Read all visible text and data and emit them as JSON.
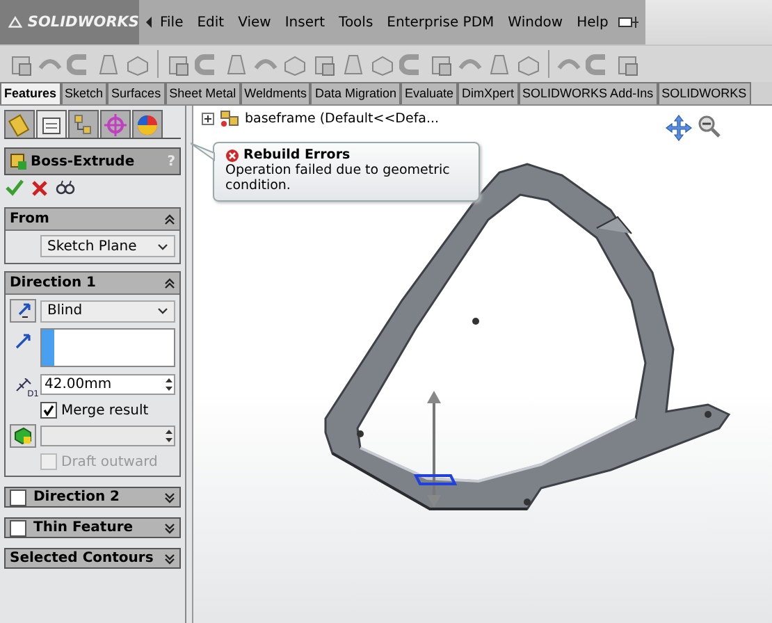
{
  "app": {
    "logo": "SOLIDWORKS"
  },
  "menu": [
    "File",
    "Edit",
    "View",
    "Insert",
    "Tools",
    "Enterprise PDM",
    "Window",
    "Help"
  ],
  "command_tabs": [
    {
      "label": "Features",
      "selected": true
    },
    {
      "label": "Sketch",
      "selected": false
    },
    {
      "label": "Surfaces",
      "selected": false
    },
    {
      "label": "Sheet Metal",
      "selected": false
    },
    {
      "label": "Weldments",
      "selected": false
    },
    {
      "label": "Data Migration",
      "selected": false
    },
    {
      "label": "Evaluate",
      "selected": false
    },
    {
      "label": "DimXpert",
      "selected": false
    },
    {
      "label": "SOLIDWORKS Add-Ins",
      "selected": false
    },
    {
      "label": "SOLIDWORKS",
      "selected": false
    }
  ],
  "panel_tabs": [
    {
      "kind": "feature",
      "selected": false
    },
    {
      "kind": "property",
      "selected": true
    },
    {
      "kind": "config",
      "selected": false
    },
    {
      "kind": "dimxpert",
      "selected": false
    },
    {
      "kind": "display",
      "selected": false
    }
  ],
  "property_manager": {
    "title": "Boss-Extrude",
    "help": "?",
    "from": {
      "title": "From",
      "value": "Sketch Plane"
    },
    "direction1": {
      "title": "Direction 1",
      "end_condition": "Blind",
      "depth_icon_label": "D1",
      "depth": "42.00mm",
      "merge_result": true,
      "merge_label": "Merge result",
      "draft_outward": {
        "label": "Draft outward",
        "checked": false,
        "disabled": true
      }
    },
    "sections": [
      {
        "kind": "checkbox",
        "title": "Direction 2",
        "checked": false
      },
      {
        "kind": "checkbox",
        "title": "Thin Feature",
        "checked": false
      },
      {
        "kind": "plain",
        "title": "Selected Contours"
      }
    ]
  },
  "tree": {
    "label": "baseframe",
    "config": "(Default<<Defa...",
    "expanded": false
  },
  "tooltip": {
    "title": "Rebuild Errors",
    "message": "Operation failed due to geometric condition."
  }
}
